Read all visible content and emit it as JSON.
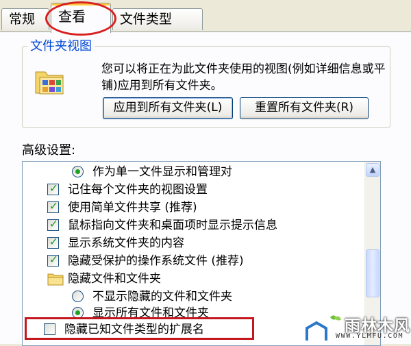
{
  "tabs": [
    {
      "label": "常规"
    },
    {
      "label": "查看"
    },
    {
      "label": "文件类型"
    }
  ],
  "folder_views": {
    "title": "文件夹视图",
    "description": "您可以将正在为此文件夹使用的视图(例如详细信息或平铺)应用到所有文件夹。",
    "apply_button": "应用到所有文件夹(L)",
    "reset_button": "重置所有文件夹(R)"
  },
  "advanced": {
    "label": "高级设置:",
    "items": [
      {
        "type": "radio",
        "checked": true,
        "label": "作为单一文件显示和管理对"
      },
      {
        "type": "checkbox",
        "checked": true,
        "label": "记住每个文件夹的视图设置"
      },
      {
        "type": "checkbox",
        "checked": true,
        "label": "使用简单文件共享 (推荐)"
      },
      {
        "type": "checkbox",
        "checked": true,
        "label": "鼠标指向文件夹和桌面项时显示提示信息"
      },
      {
        "type": "checkbox",
        "checked": true,
        "label": "显示系统文件夹的内容"
      },
      {
        "type": "checkbox",
        "checked": true,
        "label": "隐藏受保护的操作系统文件 (推荐)"
      },
      {
        "type": "folder",
        "label": "隐藏文件和文件夹"
      },
      {
        "type": "radio",
        "checked": false,
        "label": "不显示隐藏的文件和文件夹"
      },
      {
        "type": "radio",
        "checked": true,
        "label": "显示所有文件和文件夹"
      }
    ],
    "highlighted_item": {
      "type": "checkbox",
      "checked": false,
      "label": "隐藏已知文件类型的扩展名"
    }
  },
  "watermark": {
    "brand": "雨林木风",
    "url": "WWW.YLMFU.COM"
  },
  "colors": {
    "annotation_red": "#d82020",
    "check_green": "#21a121",
    "group_title_blue": "#0046d5"
  }
}
